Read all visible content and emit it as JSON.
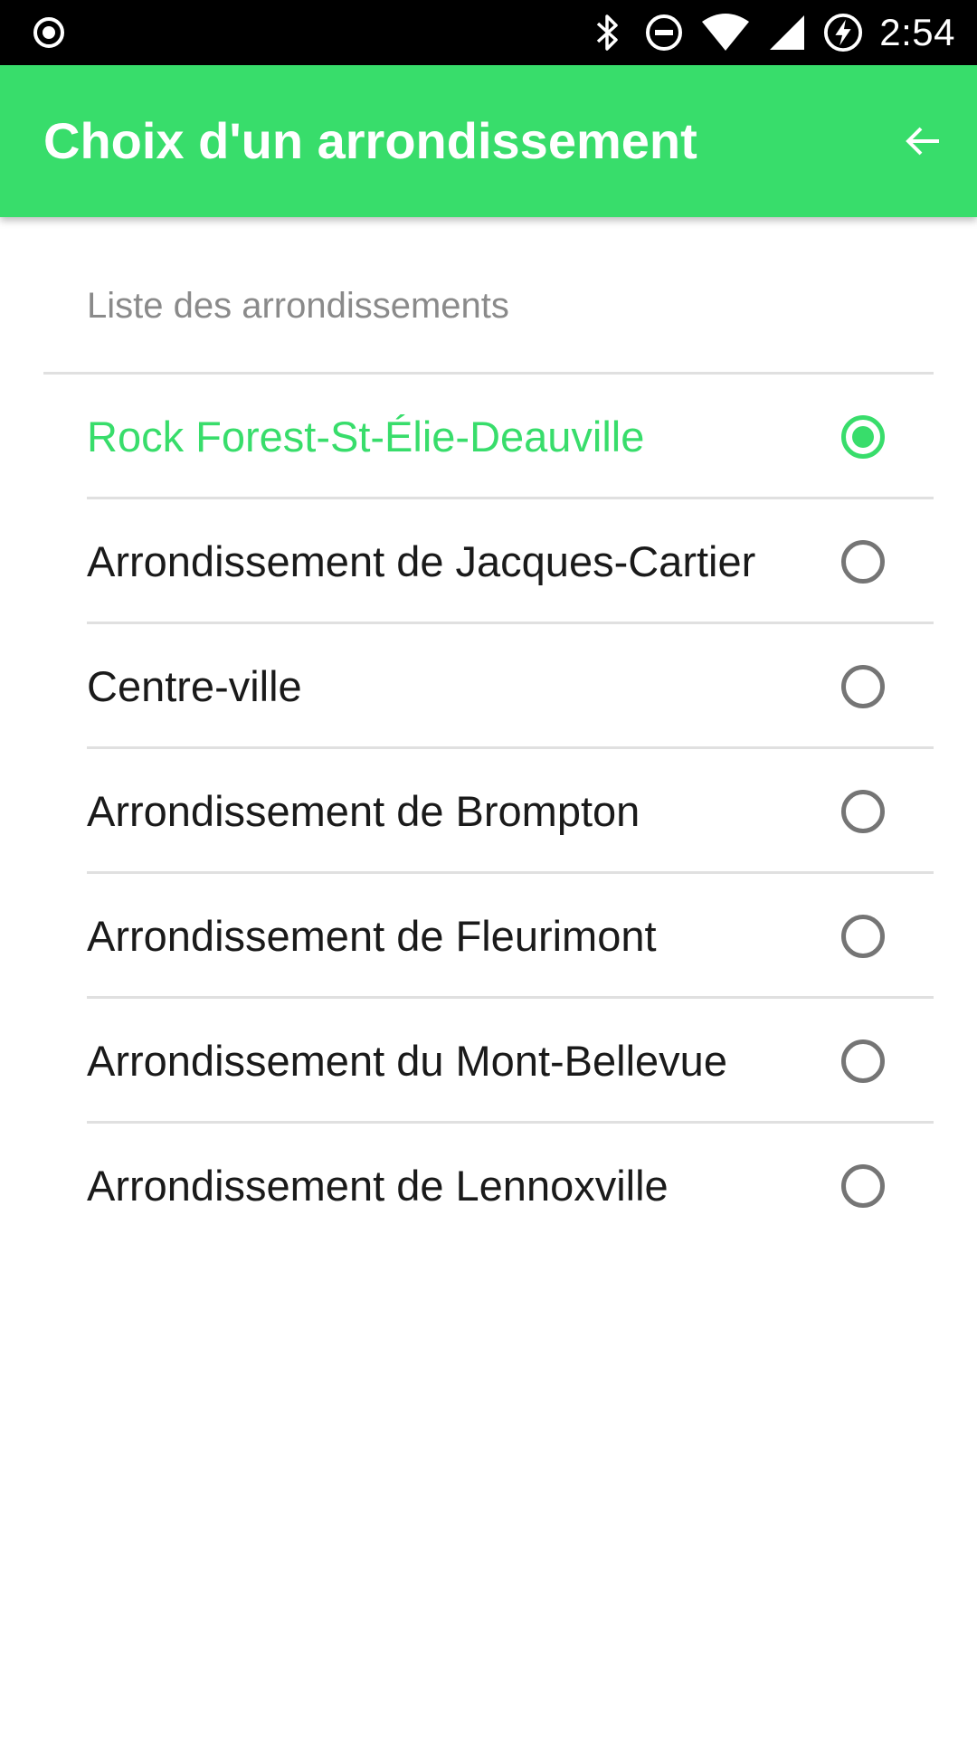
{
  "status_bar": {
    "time": "2:54",
    "left_icon": "record-icon",
    "icons": [
      "bluetooth-icon",
      "do-not-disturb-icon",
      "wifi-icon",
      "signal-icon",
      "battery-charging-icon"
    ]
  },
  "app_bar": {
    "title": "Choix d'un arrondissement",
    "back_icon": "arrow-back-icon",
    "color": "#38dd6b"
  },
  "list": {
    "header": "Liste des arrondissements",
    "selected_index": 0,
    "items": [
      {
        "label": "Rock Forest-St-Élie-Deauville",
        "selected": true
      },
      {
        "label": "Arrondissement de Jacques-Cartier",
        "selected": false
      },
      {
        "label": "Centre-ville",
        "selected": false
      },
      {
        "label": "Arrondissement de Brompton",
        "selected": false
      },
      {
        "label": "Arrondissement de Fleurimont",
        "selected": false
      },
      {
        "label": "Arrondissement du Mont-Bellevue",
        "selected": false
      },
      {
        "label": "Arrondissement de Lennoxville",
        "selected": false
      }
    ]
  }
}
